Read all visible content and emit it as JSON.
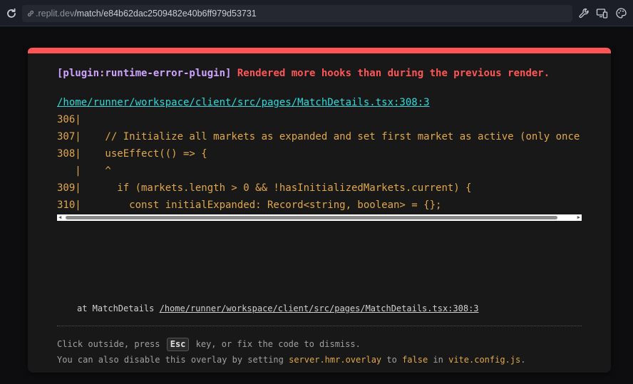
{
  "browser": {
    "url_domain": ".replit.dev",
    "url_path": "/match/e84b62dac2509482e40b6ff979d53731",
    "icons": [
      "reload-icon",
      "link-icon",
      "wrench-icon",
      "devices-icon",
      "palette-icon"
    ]
  },
  "overlay": {
    "plugin": "[plugin:runtime-error-plugin]",
    "message": "Rendered more hooks than during the previous render.",
    "file": "/home/runner/workspace/client/src/pages/MatchDetails.tsx:308:3",
    "frame_lines": [
      "306|",
      "307|    // Initialize all markets as expanded and set first market as active (only once",
      "308|    useEffect(() => {",
      "   |    ^",
      "309|      if (markets.length > 0 && !hasInitializedMarkets.current) {",
      "310|        const initialExpanded: Record<string, boolean> = {};"
    ],
    "stack_prefix": "at MatchDetails ",
    "stack_link": "/home/runner/workspace/client/src/pages/MatchDetails.tsx:308:3",
    "tip1_a": "Click outside, press ",
    "tip1_key": "Esc",
    "tip1_b": " key, or fix the code to dismiss.",
    "tip2_a": "You can also disable this overlay by setting ",
    "tip2_code1": "server.hmr.overlay",
    "tip2_b": " to ",
    "tip2_code2": "false",
    "tip2_c": " in ",
    "tip2_code3": "vite.config.js",
    "tip2_d": "."
  },
  "colors": {
    "accent_red": "#ff5555",
    "plugin_purple": "#cfa3ff",
    "link_cyan": "#2dd9da",
    "code_yellow": "#e0a84a"
  }
}
